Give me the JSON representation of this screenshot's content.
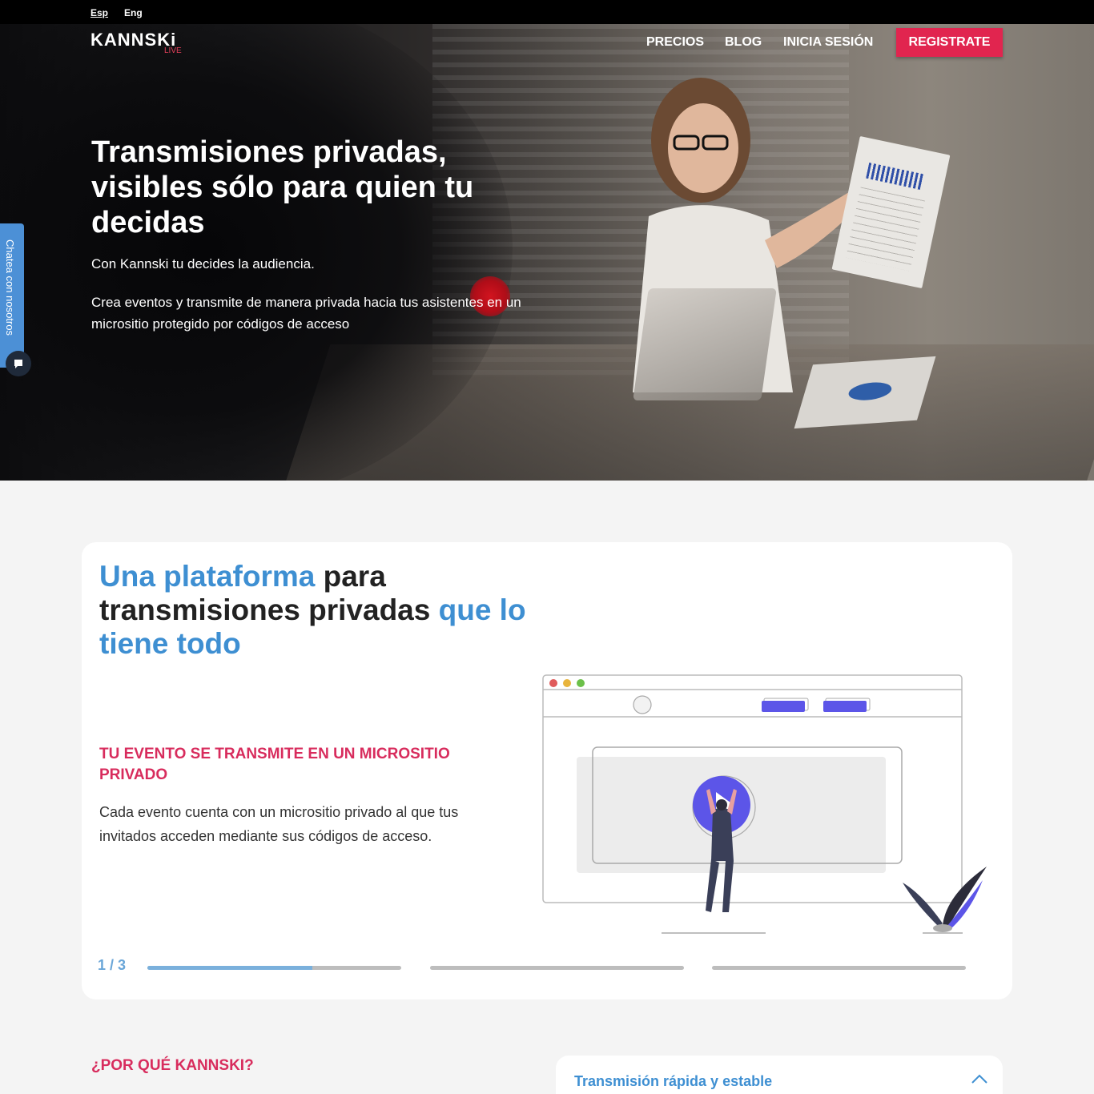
{
  "lang": {
    "es": "Esp",
    "en": "Eng"
  },
  "logo": {
    "name": "KANNSKi",
    "sub": "LIVE"
  },
  "nav": {
    "precios": "PRECIOS",
    "blog": "BLOG",
    "login": "INICIA SESIÓN",
    "register": "REGISTRATE"
  },
  "hero": {
    "title": "Transmisiones privadas, visibles sólo para quien tu decidas",
    "sub1": "Con Kannski tu decides la audiencia.",
    "sub2": "Crea eventos y transmite de manera privada hacia tus asistentes en un micrositio protegido por códigos de acceso"
  },
  "chat": {
    "label": "Chatea con nosotros",
    "icon": "chat-bubble-icon"
  },
  "card": {
    "title_a": "Una plataforma",
    "title_b": " para transmisiones privadas ",
    "title_c": "que lo tiene todo",
    "feature_title": "TU EVENTO SE TRANSMITE EN UN MICROSITIO PRIVADO",
    "feature_body": "Cada evento cuenta con un micrositio privado al que tus invitados acceden mediante sus códigos de acceso.",
    "counter": "1 / 3",
    "progress": [
      0.65,
      0,
      0
    ]
  },
  "why": {
    "title": "¿POR QUÉ KANNSKI?",
    "accordion_title": "Transmisión rápida y estable",
    "accordion_icon": "chevron-up-icon"
  },
  "colors": {
    "accent_red": "#e1254f",
    "accent_blue": "#3e8fd2",
    "feature_red": "#d82c5d"
  }
}
